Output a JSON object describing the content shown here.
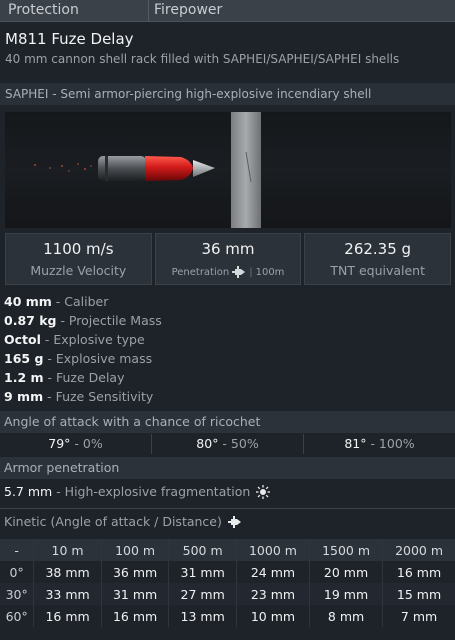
{
  "tabs": [
    "Protection",
    "Firepower"
  ],
  "shell": {
    "name": "M811 Fuze Delay",
    "description": "40 mm cannon shell rack filled with SAPHEI/SAPHEI/SAPHEI shells",
    "type_line": "SAPHEI - Semi armor-piercing high-explosive incendiary shell"
  },
  "stats": {
    "muzzle_velocity": {
      "value": "1100 m/s",
      "label": "Muzzle Velocity"
    },
    "penetration": {
      "value": "36 mm",
      "label": "Penetration",
      "distance": "100m"
    },
    "tnt": {
      "value": "262.35 g",
      "label": "TNT equivalent"
    }
  },
  "properties": [
    {
      "value": "40 mm",
      "label": " - Caliber"
    },
    {
      "value": "0.87 kg",
      "label": " - Projectile Mass"
    },
    {
      "value": "Octol",
      "label": " - Explosive type"
    },
    {
      "value": "165 g",
      "label": " - Explosive mass"
    },
    {
      "value": "1.2 m",
      "label": " - Fuze Delay"
    },
    {
      "value": "9 mm",
      "label": " - Fuze Sensitivity"
    }
  ],
  "ricochet": {
    "title": "Angle of attack with a chance of ricochet",
    "cells": [
      {
        "angle": "79°",
        "chance": " - 0%"
      },
      {
        "angle": "80°",
        "chance": " - 50%"
      },
      {
        "angle": "81°",
        "chance": " - 100%"
      }
    ]
  },
  "armor": {
    "title": "Armor penetration",
    "he_value": "5.7 mm",
    "he_label": " - High-explosive fragmentation",
    "kinetic_title": "Kinetic (Angle of attack / Distance)"
  },
  "penetration_table": {
    "corner": "-",
    "distances": [
      "10 m",
      "100 m",
      "500 m",
      "1000 m",
      "1500 m",
      "2000 m"
    ],
    "rows": [
      {
        "angle": "0°",
        "values": [
          "38 mm",
          "36 mm",
          "31 mm",
          "24 mm",
          "20 mm",
          "16 mm"
        ]
      },
      {
        "angle": "30°",
        "values": [
          "33 mm",
          "31 mm",
          "27 mm",
          "23 mm",
          "19 mm",
          "15 mm"
        ]
      },
      {
        "angle": "60°",
        "values": [
          "16 mm",
          "16 mm",
          "13 mm",
          "10 mm",
          "8 mm",
          "7 mm"
        ]
      }
    ]
  },
  "colors": {
    "background": "#1e2329",
    "panel": "#2c323a",
    "shell_red": "#d11a1a"
  },
  "icons": [
    "penetration-icon",
    "explosion-icon",
    "kinetic-icon"
  ]
}
